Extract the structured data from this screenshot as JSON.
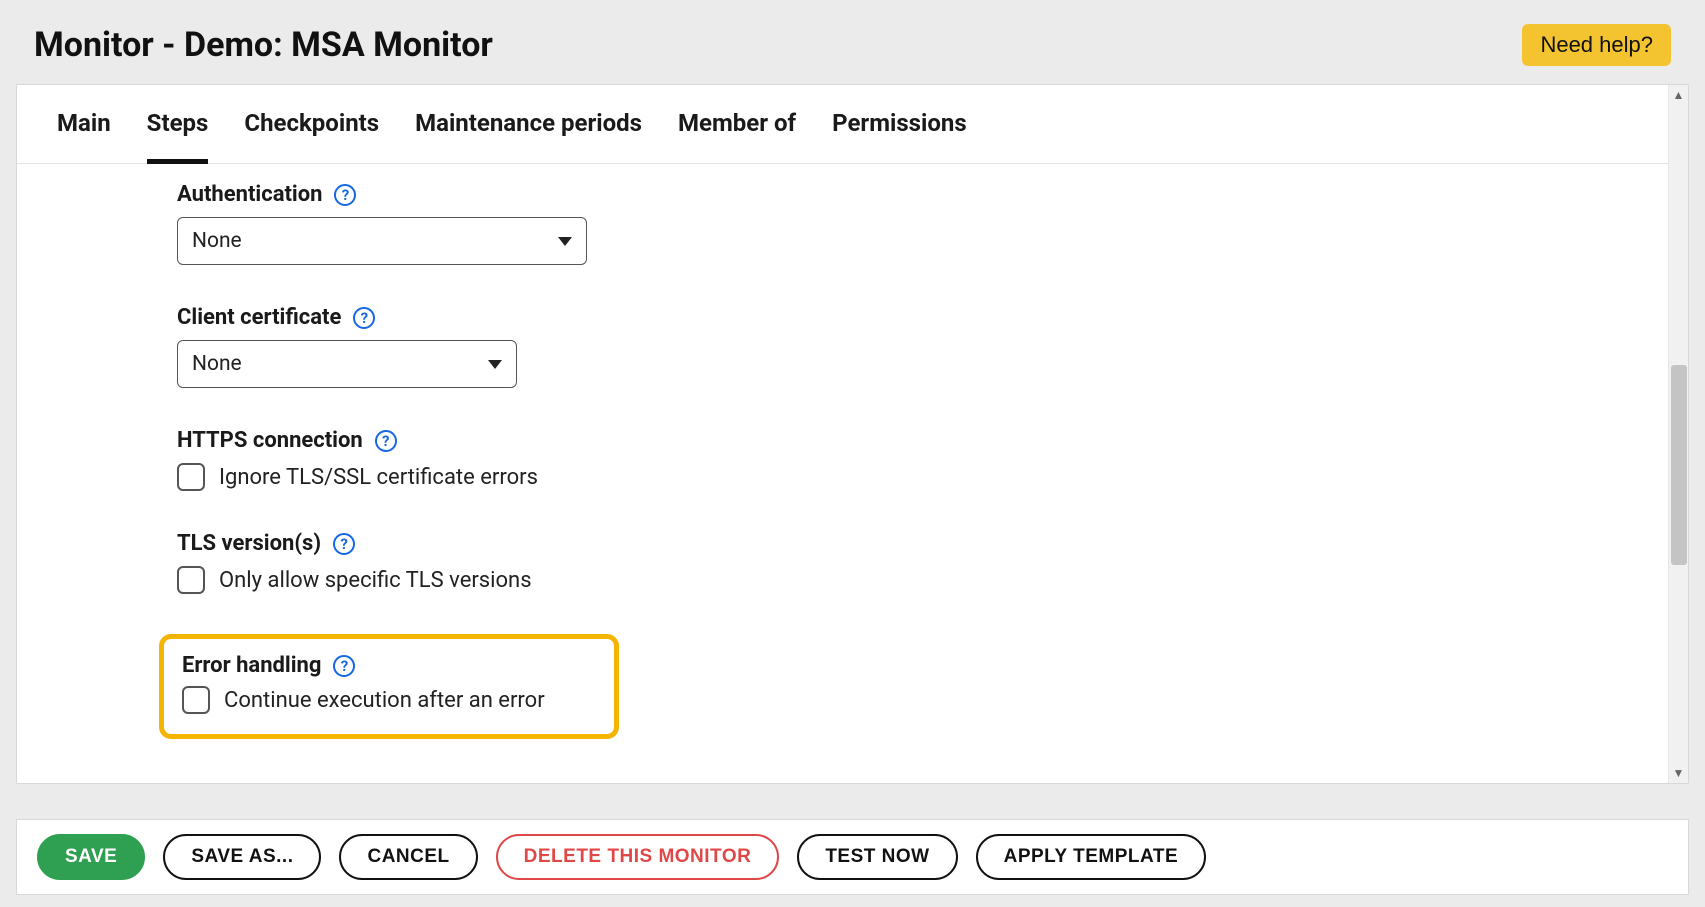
{
  "header": {
    "title": "Monitor - Demo: MSA Monitor",
    "help": "Need help?"
  },
  "tabs": [
    {
      "label": "Main",
      "active": false
    },
    {
      "label": "Steps",
      "active": true
    },
    {
      "label": "Checkpoints",
      "active": false
    },
    {
      "label": "Maintenance periods",
      "active": false
    },
    {
      "label": "Member of",
      "active": false
    },
    {
      "label": "Permissions",
      "active": false
    }
  ],
  "form": {
    "authentication": {
      "label": "Authentication",
      "value": "None"
    },
    "clientCert": {
      "label": "Client certificate",
      "value": "None"
    },
    "httpsConn": {
      "label": "HTTPS connection",
      "checkbox": "Ignore TLS/SSL certificate errors"
    },
    "tlsVersions": {
      "label": "TLS version(s)",
      "checkbox": "Only allow specific TLS versions"
    },
    "errorHandling": {
      "label": "Error handling",
      "checkbox": "Continue execution after an error"
    }
  },
  "footer": {
    "save": "SAVE",
    "saveAs": "SAVE AS...",
    "cancel": "CANCEL",
    "delete": "DELETE THIS MONITOR",
    "testNow": "TEST NOW",
    "applyTemplate": "APPLY TEMPLATE"
  }
}
